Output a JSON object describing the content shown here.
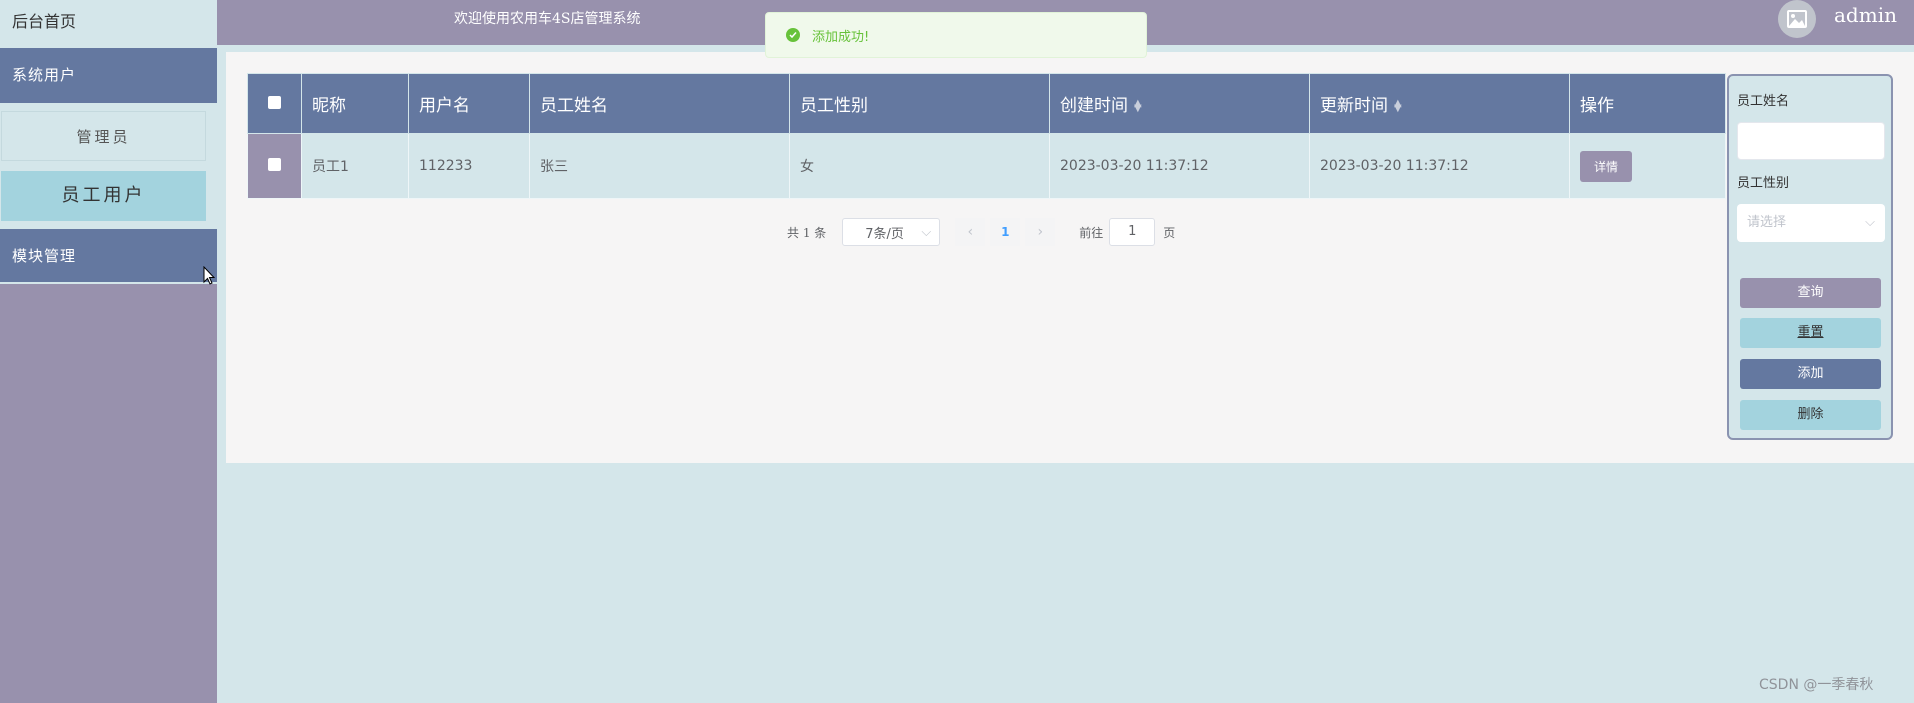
{
  "sidebar": {
    "home": "后台首页",
    "groups": [
      {
        "label": "系统用户",
        "items": [
          {
            "label": "管理员"
          },
          {
            "label": "员工用户"
          }
        ]
      },
      {
        "label": "模块管理"
      }
    ]
  },
  "header": {
    "welcome": "欢迎使用农用车4S店管理系统",
    "user": "admin"
  },
  "toast": {
    "message": "添加成功!"
  },
  "table": {
    "columns": [
      "昵称",
      "用户名",
      "员工姓名",
      "员工性别",
      "创建时间",
      "更新时间",
      "操作"
    ],
    "rows": [
      {
        "nickname": "员工1",
        "username": "112233",
        "name": "张三",
        "gender": "女",
        "created": "2023-03-20 11:37:12",
        "updated": "2023-03-20 11:37:12",
        "action": "详情"
      }
    ]
  },
  "pagination": {
    "total": "共 1 条",
    "page_size": "7条/页",
    "current": "1",
    "goto_label": "前往",
    "goto_value": "1",
    "page_word": "页"
  },
  "search": {
    "name_label": "员工姓名",
    "gender_label": "员工性别",
    "gender_placeholder": "请选择",
    "query": "查询",
    "reset": "重置",
    "add": "添加",
    "delete": "删除"
  },
  "watermark": "CSDN @一季春秋",
  "colors": {
    "primary": "#6478a0",
    "secondary": "#9891ad",
    "background": "#d4e6ea",
    "accent": "#a3d3de",
    "success": "#67c23a"
  }
}
